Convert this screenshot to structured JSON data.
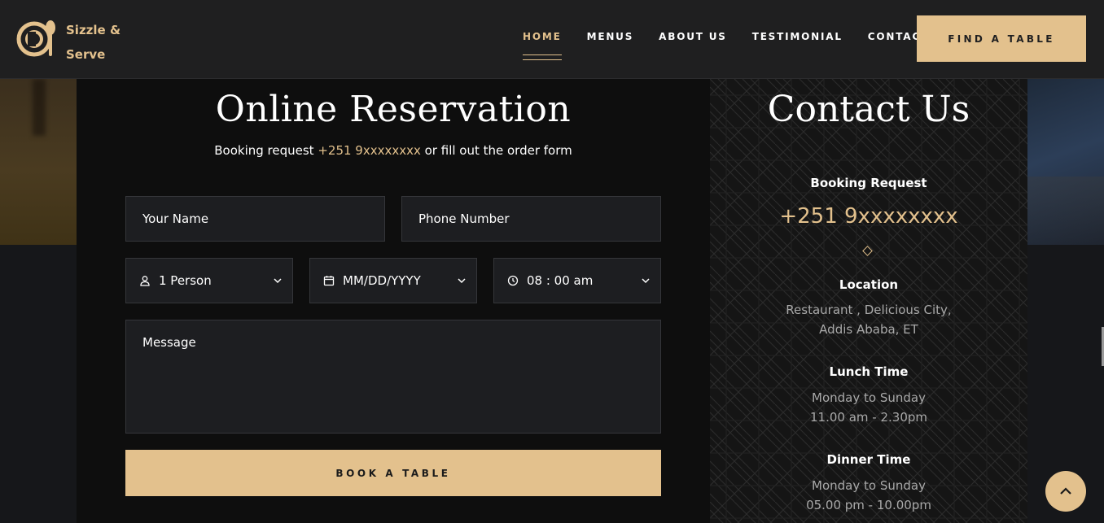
{
  "brand": {
    "line1": "Sizzle &",
    "line2": "Serve",
    "accent": "#e3c18d"
  },
  "nav": {
    "items": [
      {
        "label": "HOME",
        "active": true
      },
      {
        "label": "MENUS"
      },
      {
        "label": "ABOUT US"
      },
      {
        "label": "TESTIMONIAL"
      },
      {
        "label": "CONTACT"
      }
    ],
    "cta": "FIND A TABLE"
  },
  "reservation": {
    "title": "Online Reservation",
    "subtitle_prefix": "Booking request ",
    "subtitle_phone": "+251 9xxxxxxxx",
    "subtitle_suffix": " or fill out the order form",
    "name_placeholder": "Your Name",
    "phone_placeholder": "Phone Number",
    "persons": {
      "value": "1 Person",
      "icon": "user-icon"
    },
    "date": {
      "value": "MM/DD/YYYY",
      "icon": "calendar-icon"
    },
    "time": {
      "value": "08 : 00 am",
      "icon": "clock-icon"
    },
    "message_placeholder": "Message",
    "submit": "BOOK A TABLE"
  },
  "contact": {
    "title": "Contact Us",
    "booking_label": "Booking Request",
    "booking_phone": "+251 9xxxxxxxx",
    "location_label": "Location",
    "location_line1": "Restaurant , Delicious City,",
    "location_line2": "Addis Ababa, ET",
    "lunch_label": "Lunch Time",
    "lunch_days": "Monday to Sunday",
    "lunch_hours": "11.00 am - 2.30pm",
    "dinner_label": "Dinner Time",
    "dinner_days": "Monday to Sunday",
    "dinner_hours": "05.00 pm - 10.00pm"
  }
}
